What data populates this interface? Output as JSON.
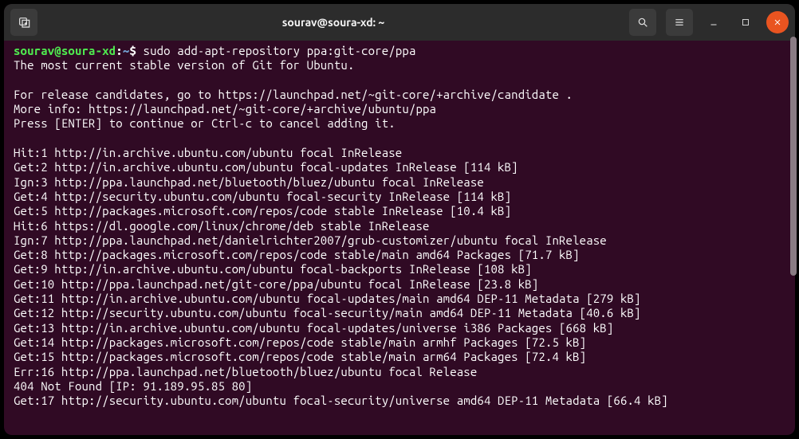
{
  "titlebar": {
    "title": "sourav@soura-xd: ~"
  },
  "prompt": {
    "user_host": "sourav@soura-xd",
    "colon": ":",
    "path": "~",
    "dollar": "$",
    "command": "sudo add-apt-repository ppa:git-core/ppa"
  },
  "output": [
    " The most current stable version of Git for Ubuntu.",
    "",
    "For release candidates, go to https://launchpad.net/~git-core/+archive/candidate .",
    " More info: https://launchpad.net/~git-core/+archive/ubuntu/ppa",
    "Press [ENTER] to continue or Ctrl-c to cancel adding it.",
    "",
    "Hit:1 http://in.archive.ubuntu.com/ubuntu focal InRelease",
    "Get:2 http://in.archive.ubuntu.com/ubuntu focal-updates InRelease [114 kB]",
    "Ign:3 http://ppa.launchpad.net/bluetooth/bluez/ubuntu focal InRelease",
    "Get:4 http://security.ubuntu.com/ubuntu focal-security InRelease [114 kB]",
    "Get:5 http://packages.microsoft.com/repos/code stable InRelease [10.4 kB]",
    "Hit:6 https://dl.google.com/linux/chrome/deb stable InRelease",
    "Ign:7 http://ppa.launchpad.net/danielrichter2007/grub-customizer/ubuntu focal InRelease",
    "Get:8 http://packages.microsoft.com/repos/code stable/main amd64 Packages [71.7 kB]",
    "Get:9 http://in.archive.ubuntu.com/ubuntu focal-backports InRelease [108 kB]",
    "Get:10 http://ppa.launchpad.net/git-core/ppa/ubuntu focal InRelease [23.8 kB]",
    "Get:11 http://in.archive.ubuntu.com/ubuntu focal-updates/main amd64 DEP-11 Metadata [279 kB]",
    "Get:12 http://security.ubuntu.com/ubuntu focal-security/main amd64 DEP-11 Metadata [40.6 kB]",
    "Get:13 http://in.archive.ubuntu.com/ubuntu focal-updates/universe i386 Packages [668 kB]",
    "Get:14 http://packages.microsoft.com/repos/code stable/main armhf Packages [72.5 kB]",
    "Get:15 http://packages.microsoft.com/repos/code stable/main arm64 Packages [72.4 kB]",
    "Err:16 http://ppa.launchpad.net/bluetooth/bluez/ubuntu focal Release",
    "  404  Not Found [IP: 91.189.95.85 80]",
    "Get:17 http://security.ubuntu.com/ubuntu focal-security/universe amd64 DEP-11 Metadata [66.4 kB]"
  ]
}
